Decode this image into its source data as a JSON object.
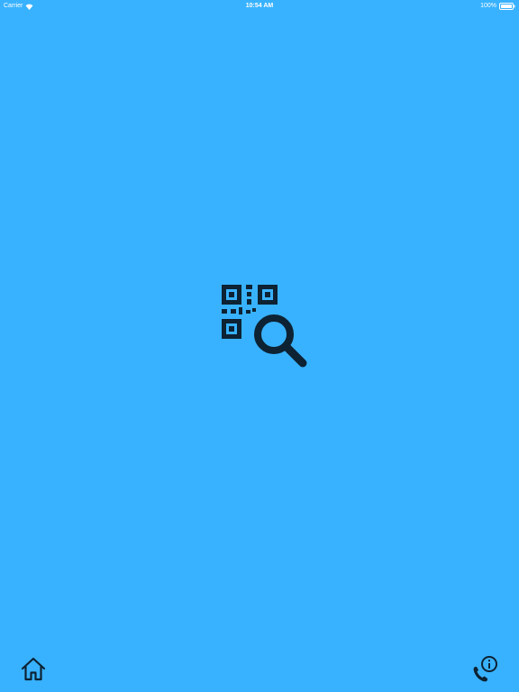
{
  "status_bar": {
    "carrier": "Carrier",
    "time": "10:54 AM",
    "battery": "100%",
    "icons": [
      "wifi-icon",
      "battery-icon"
    ]
  },
  "main": {
    "logo_icon": "qr-code-search-icon"
  },
  "bottom_bar": {
    "home_icon": "home-icon",
    "contact_icon": "phone-info-icon"
  },
  "colors": {
    "background": "#38b2ff",
    "icon_dark": "#0d2233",
    "status_text": "#ffffff"
  }
}
